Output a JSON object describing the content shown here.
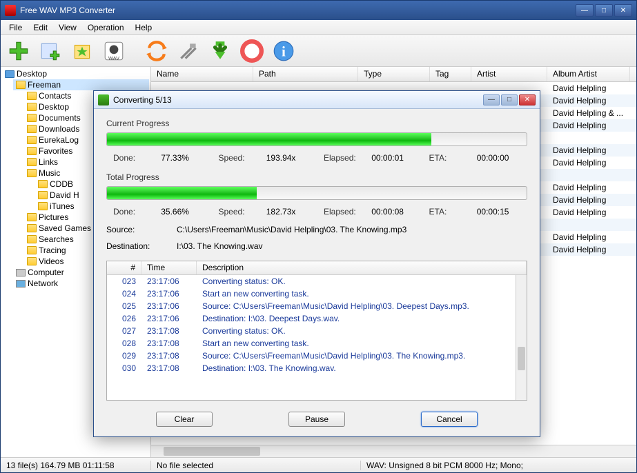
{
  "app": {
    "title": "Free WAV MP3 Converter"
  },
  "menu": {
    "file": "File",
    "edit": "Edit",
    "view": "View",
    "operation": "Operation",
    "help": "Help"
  },
  "sidebar": {
    "root": "Desktop",
    "user": "Freeman",
    "items": [
      "Contacts",
      "Desktop",
      "Documents",
      "Downloads",
      "EurekaLog",
      "Favorites",
      "Links",
      "Music"
    ],
    "music_items": [
      "CDDB",
      "David H",
      "iTunes"
    ],
    "after": [
      "Pictures",
      "Saved Games",
      "Searches",
      "Tracing",
      "Videos"
    ],
    "computer": "Computer",
    "network": "Network"
  },
  "columns": {
    "name": "Name",
    "path": "Path",
    "type": "Type",
    "tag": "Tag",
    "artist": "Artist",
    "album_artist": "Album Artist"
  },
  "artists": [
    "David Helpling",
    "David Helpling",
    "David Helpling & ...",
    "David Helpling",
    "",
    "David Helpling",
    "David Helpling",
    "",
    "David Helpling",
    "David Helpling",
    "David Helpling",
    "",
    "David Helpling",
    "David Helpling"
  ],
  "status": {
    "left": "13 file(s)   164.79 MB   01:11:58",
    "mid": "No file selected",
    "right": "WAV:  Unsigned 8 bit PCM  8000 Hz;  Mono;"
  },
  "dialog": {
    "title": "Converting 5/13",
    "current_label": "Current Progress",
    "total_label": "Total Progress",
    "done_label": "Done:",
    "speed_label": "Speed:",
    "elapsed_label": "Elapsed:",
    "eta_label": "ETA:",
    "current": {
      "done": "77.33%",
      "speed": "193.94x",
      "elapsed": "00:00:01",
      "eta": "00:00:00",
      "pct": 77.33
    },
    "total": {
      "done": "35.66%",
      "speed": "182.73x",
      "elapsed": "00:00:08",
      "eta": "00:00:15",
      "pct": 35.66
    },
    "source_label": "Source:",
    "source": "C:\\Users\\Freeman\\Music\\David Helpling\\03. The Knowing.mp3",
    "dest_label": "Destination:",
    "dest": "I:\\03. The Knowing.wav",
    "log_cols": {
      "n": "#",
      "time": "Time",
      "desc": "Description"
    },
    "log": [
      {
        "n": "023",
        "t": "23:17:06",
        "d": "Converting status: OK."
      },
      {
        "n": "024",
        "t": "23:17:06",
        "d": "Start an new converting task."
      },
      {
        "n": "025",
        "t": "23:17:06",
        "d": "Source:  C:\\Users\\Freeman\\Music\\David Helpling\\03. Deepest Days.mp3."
      },
      {
        "n": "026",
        "t": "23:17:06",
        "d": "Destination: I:\\03. Deepest Days.wav."
      },
      {
        "n": "027",
        "t": "23:17:08",
        "d": "Converting status: OK."
      },
      {
        "n": "028",
        "t": "23:17:08",
        "d": "Start an new converting task."
      },
      {
        "n": "029",
        "t": "23:17:08",
        "d": "Source:  C:\\Users\\Freeman\\Music\\David Helpling\\03. The Knowing.mp3."
      },
      {
        "n": "030",
        "t": "23:17:08",
        "d": "Destination: I:\\03. The Knowing.wav."
      }
    ],
    "buttons": {
      "clear": "Clear",
      "pause": "Pause",
      "cancel": "Cancel"
    }
  }
}
